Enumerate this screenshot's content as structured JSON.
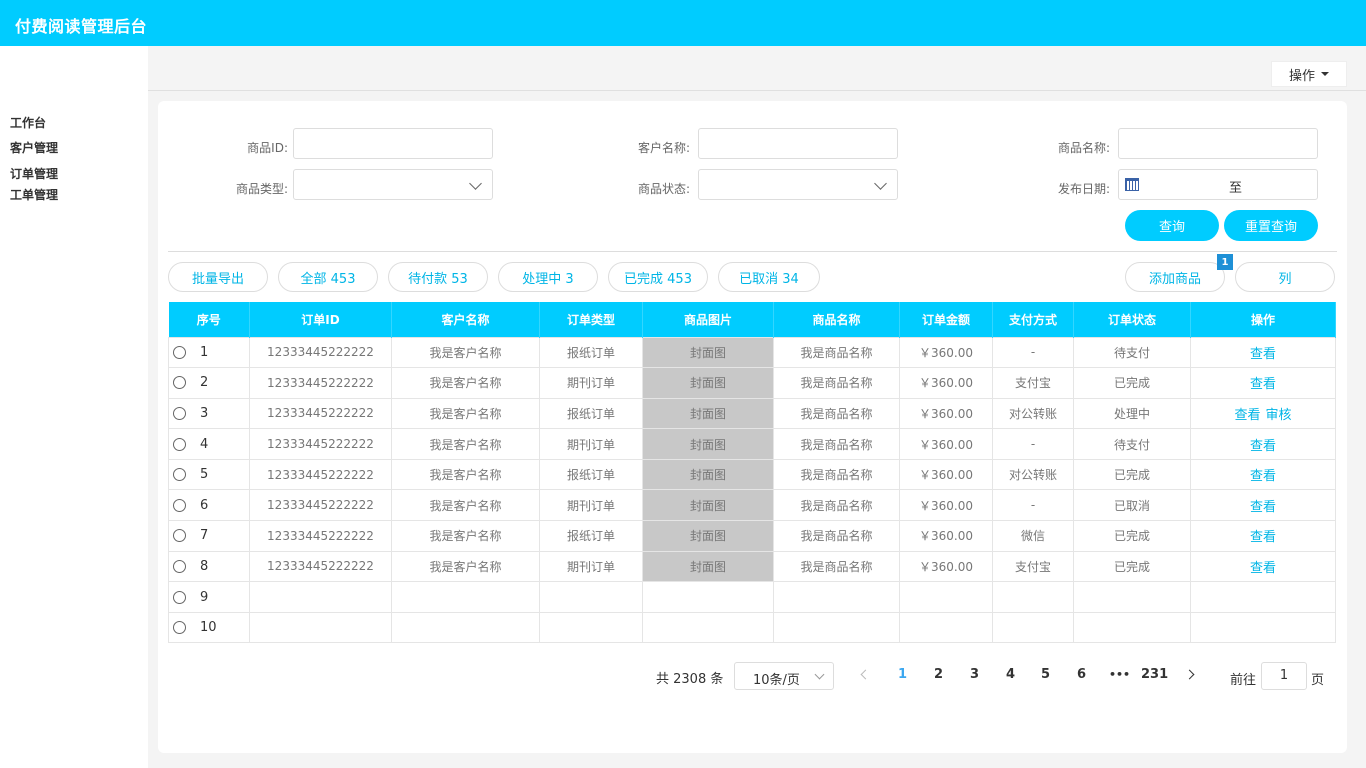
{
  "header": {
    "title": "付费阅读管理后台"
  },
  "sidebar": {
    "items": [
      {
        "label": "工作台"
      },
      {
        "label": "客户管理"
      },
      {
        "label": "订单管理"
      },
      {
        "label": "工单管理"
      }
    ]
  },
  "toolbar": {
    "operate_label": "操作"
  },
  "filters": {
    "product_id_label": "商品ID:",
    "customer_name_label": "客户名称:",
    "product_name_label": "商品名称:",
    "product_type_label": "商品类型:",
    "product_status_label": "商品状态:",
    "publish_date_label": "发布日期:",
    "date_separator": "至",
    "search_label": "查询",
    "reset_label": "重置查询"
  },
  "actions": {
    "export_label": "批量导出",
    "tabs": [
      {
        "label": "全部 453"
      },
      {
        "label": "待付款 53"
      },
      {
        "label": "处理中 3"
      },
      {
        "label": "已完成 453"
      },
      {
        "label": "已取消 34"
      }
    ],
    "add_product_label": "添加商品",
    "column_label": "列",
    "badge_count": "1"
  },
  "table": {
    "headers": [
      "序号",
      "订单ID",
      "客户名称",
      "订单类型",
      "商品图片",
      "商品名称",
      "订单金额",
      "支付方式",
      "订单状态",
      "操作"
    ],
    "rows": [
      {
        "idx": "1",
        "order_id": "12333445222222",
        "customer": "我是客户名称",
        "type": "报纸订单",
        "image": "封面图",
        "product": "我是商品名称",
        "amount": "￥360.00",
        "payment": "-",
        "status": "待支付",
        "ops": [
          "查看"
        ]
      },
      {
        "idx": "2",
        "order_id": "12333445222222",
        "customer": "我是客户名称",
        "type": "期刊订单",
        "image": "封面图",
        "product": "我是商品名称",
        "amount": "￥360.00",
        "payment": "支付宝",
        "status": "已完成",
        "ops": [
          "查看"
        ]
      },
      {
        "idx": "3",
        "order_id": "12333445222222",
        "customer": "我是客户名称",
        "type": "报纸订单",
        "image": "封面图",
        "product": "我是商品名称",
        "amount": "￥360.00",
        "payment": "对公转账",
        "status": "处理中",
        "ops": [
          "查看",
          "审核"
        ]
      },
      {
        "idx": "4",
        "order_id": "12333445222222",
        "customer": "我是客户名称",
        "type": "期刊订单",
        "image": "封面图",
        "product": "我是商品名称",
        "amount": "￥360.00",
        "payment": "-",
        "status": "待支付",
        "ops": [
          "查看"
        ]
      },
      {
        "idx": "5",
        "order_id": "12333445222222",
        "customer": "我是客户名称",
        "type": "报纸订单",
        "image": "封面图",
        "product": "我是商品名称",
        "amount": "￥360.00",
        "payment": "对公转账",
        "status": "已完成",
        "ops": [
          "查看"
        ]
      },
      {
        "idx": "6",
        "order_id": "12333445222222",
        "customer": "我是客户名称",
        "type": "期刊订单",
        "image": "封面图",
        "product": "我是商品名称",
        "amount": "￥360.00",
        "payment": "-",
        "status": "已取消",
        "ops": [
          "查看"
        ]
      },
      {
        "idx": "7",
        "order_id": "12333445222222",
        "customer": "我是客户名称",
        "type": "报纸订单",
        "image": "封面图",
        "product": "我是商品名称",
        "amount": "￥360.00",
        "payment": "微信",
        "status": "已完成",
        "ops": [
          "查看"
        ]
      },
      {
        "idx": "8",
        "order_id": "12333445222222",
        "customer": "我是客户名称",
        "type": "期刊订单",
        "image": "封面图",
        "product": "我是商品名称",
        "amount": "￥360.00",
        "payment": "支付宝",
        "status": "已完成",
        "ops": [
          "查看"
        ]
      },
      {
        "idx": "9",
        "order_id": "",
        "customer": "",
        "type": "",
        "image": "",
        "product": "",
        "amount": "",
        "payment": "",
        "status": "",
        "ops": []
      },
      {
        "idx": "10",
        "order_id": "",
        "customer": "",
        "type": "",
        "image": "",
        "product": "",
        "amount": "",
        "payment": "",
        "status": "",
        "ops": []
      }
    ]
  },
  "pagination": {
    "total_label": "共 2308 条",
    "page_size": "10条/页",
    "pages": [
      "1",
      "2",
      "3",
      "4",
      "5",
      "6",
      "•••",
      "231"
    ],
    "current_page": "1",
    "goto_label": "前往",
    "goto_value": "1",
    "page_suffix": "页"
  },
  "colors": {
    "accent": "#00ccff",
    "link": "#00b5e6",
    "image_placeholder": "#c8c8c8"
  }
}
